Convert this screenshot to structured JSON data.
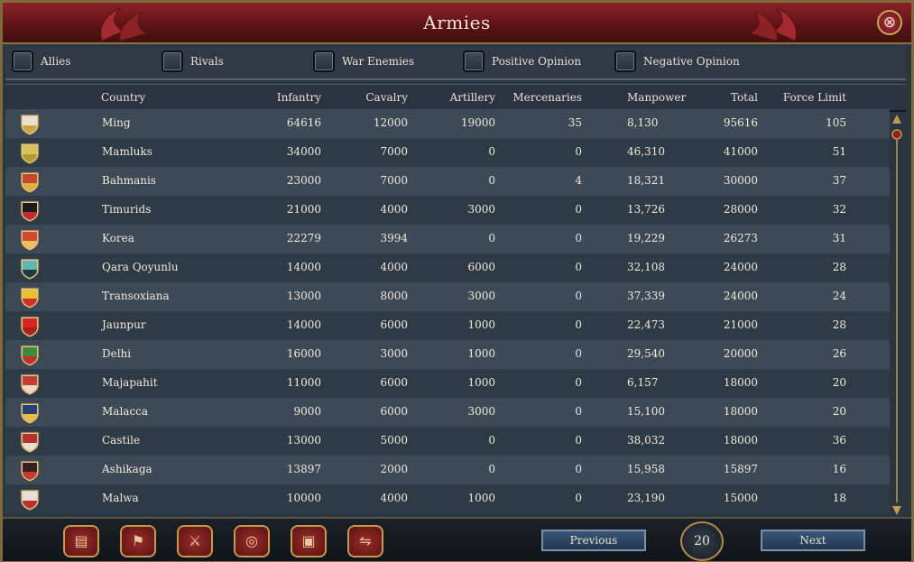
{
  "window": {
    "title": "Armies",
    "close_symbol": "⊗"
  },
  "filters": [
    "Allies",
    "Rivals",
    "War Enemies",
    "Positive Opinion",
    "Negative Opinion"
  ],
  "columns": [
    "Country",
    "Infantry",
    "Cavalry",
    "Artillery",
    "Mercenaries",
    "Manpower",
    "Total",
    "Force Limit"
  ],
  "rows": [
    {
      "country": "Ming",
      "infantry": "64616",
      "cavalry": "12000",
      "artillery": "19000",
      "mercenaries": "35",
      "manpower": "8,130",
      "total": "95616",
      "force_limit": "105",
      "flag_colors": [
        "#e8e2cf",
        "#c9a640"
      ]
    },
    {
      "country": "Mamluks",
      "infantry": "34000",
      "cavalry": "7000",
      "artillery": "0",
      "mercenaries": "0",
      "manpower": "46,310",
      "total": "41000",
      "force_limit": "51",
      "flag_colors": [
        "#d8c25a",
        "#b59a33"
      ]
    },
    {
      "country": "Bahmanis",
      "infantry": "23000",
      "cavalry": "7000",
      "artillery": "0",
      "mercenaries": "4",
      "manpower": "18,321",
      "total": "30000",
      "force_limit": "37",
      "flag_colors": [
        "#c64a2a",
        "#e0b040"
      ]
    },
    {
      "country": "Timurids",
      "infantry": "21000",
      "cavalry": "4000",
      "artillery": "3000",
      "mercenaries": "0",
      "manpower": "13,726",
      "total": "28000",
      "force_limit": "32",
      "flag_colors": [
        "#1f1a22",
        "#c22a2a"
      ]
    },
    {
      "country": "Korea",
      "infantry": "22279",
      "cavalry": "3994",
      "artillery": "0",
      "mercenaries": "0",
      "manpower": "19,229",
      "total": "26273",
      "force_limit": "31",
      "flag_colors": [
        "#d2472e",
        "#f0c060"
      ]
    },
    {
      "country": "Qara Qoyunlu",
      "infantry": "14000",
      "cavalry": "4000",
      "artillery": "6000",
      "mercenaries": "0",
      "manpower": "32,108",
      "total": "24000",
      "force_limit": "28",
      "flag_colors": [
        "#5fb8b0",
        "#1d3a3e"
      ]
    },
    {
      "country": "Transoxiana",
      "infantry": "13000",
      "cavalry": "8000",
      "artillery": "3000",
      "mercenaries": "0",
      "manpower": "37,339",
      "total": "24000",
      "force_limit": "24",
      "flag_colors": [
        "#e8c030",
        "#d0302a"
      ]
    },
    {
      "country": "Jaunpur",
      "infantry": "14000",
      "cavalry": "6000",
      "artillery": "1000",
      "mercenaries": "0",
      "manpower": "22,473",
      "total": "21000",
      "force_limit": "28",
      "flag_colors": [
        "#d8261e",
        "#a8201a"
      ]
    },
    {
      "country": "Delhi",
      "infantry": "16000",
      "cavalry": "3000",
      "artillery": "1000",
      "mercenaries": "0",
      "manpower": "29,540",
      "total": "20000",
      "force_limit": "26",
      "flag_colors": [
        "#3c8a3a",
        "#c0302a"
      ]
    },
    {
      "country": "Majapahit",
      "infantry": "11000",
      "cavalry": "6000",
      "artillery": "1000",
      "mercenaries": "0",
      "manpower": "6,157",
      "total": "18000",
      "force_limit": "20",
      "flag_colors": [
        "#c83a34",
        "#f0d8c0"
      ]
    },
    {
      "country": "Malacca",
      "infantry": "9000",
      "cavalry": "6000",
      "artillery": "3000",
      "mercenaries": "0",
      "manpower": "15,100",
      "total": "18000",
      "force_limit": "20",
      "flag_colors": [
        "#27407c",
        "#e8c040"
      ]
    },
    {
      "country": "Castile",
      "infantry": "13000",
      "cavalry": "5000",
      "artillery": "0",
      "mercenaries": "0",
      "manpower": "38,032",
      "total": "18000",
      "force_limit": "36",
      "flag_colors": [
        "#b8302a",
        "#e8e0d0"
      ]
    },
    {
      "country": "Ashikaga",
      "infantry": "13897",
      "cavalry": "2000",
      "artillery": "0",
      "mercenaries": "0",
      "manpower": "15,958",
      "total": "15897",
      "force_limit": "16",
      "flag_colors": [
        "#3a2020",
        "#c83a34"
      ]
    },
    {
      "country": "Malwa",
      "infantry": "10000",
      "cavalry": "4000",
      "artillery": "1000",
      "mercenaries": "0",
      "manpower": "23,190",
      "total": "15000",
      "force_limit": "18",
      "flag_colors": [
        "#e8e0d8",
        "#c0302a"
      ]
    }
  ],
  "toolbar": {
    "buttons": [
      {
        "icon": "scroll-icon",
        "glyph": "▤"
      },
      {
        "icon": "flag-icon",
        "glyph": "⚑"
      },
      {
        "icon": "crossed-swords-icon",
        "glyph": "⚔"
      },
      {
        "icon": "coins-icon",
        "glyph": "◎"
      },
      {
        "icon": "crate-icon",
        "glyph": "▣"
      },
      {
        "icon": "handshake-icon",
        "glyph": "⇋"
      }
    ]
  },
  "pagination": {
    "previous": "Previous",
    "page": "20",
    "next": "Next"
  },
  "colors": {
    "title_bar": "#7a1b1f",
    "border_gold": "#c49a4e",
    "row_odd": "#3d4957",
    "row_even": "#2f3a47",
    "text": "#f0ead9"
  }
}
